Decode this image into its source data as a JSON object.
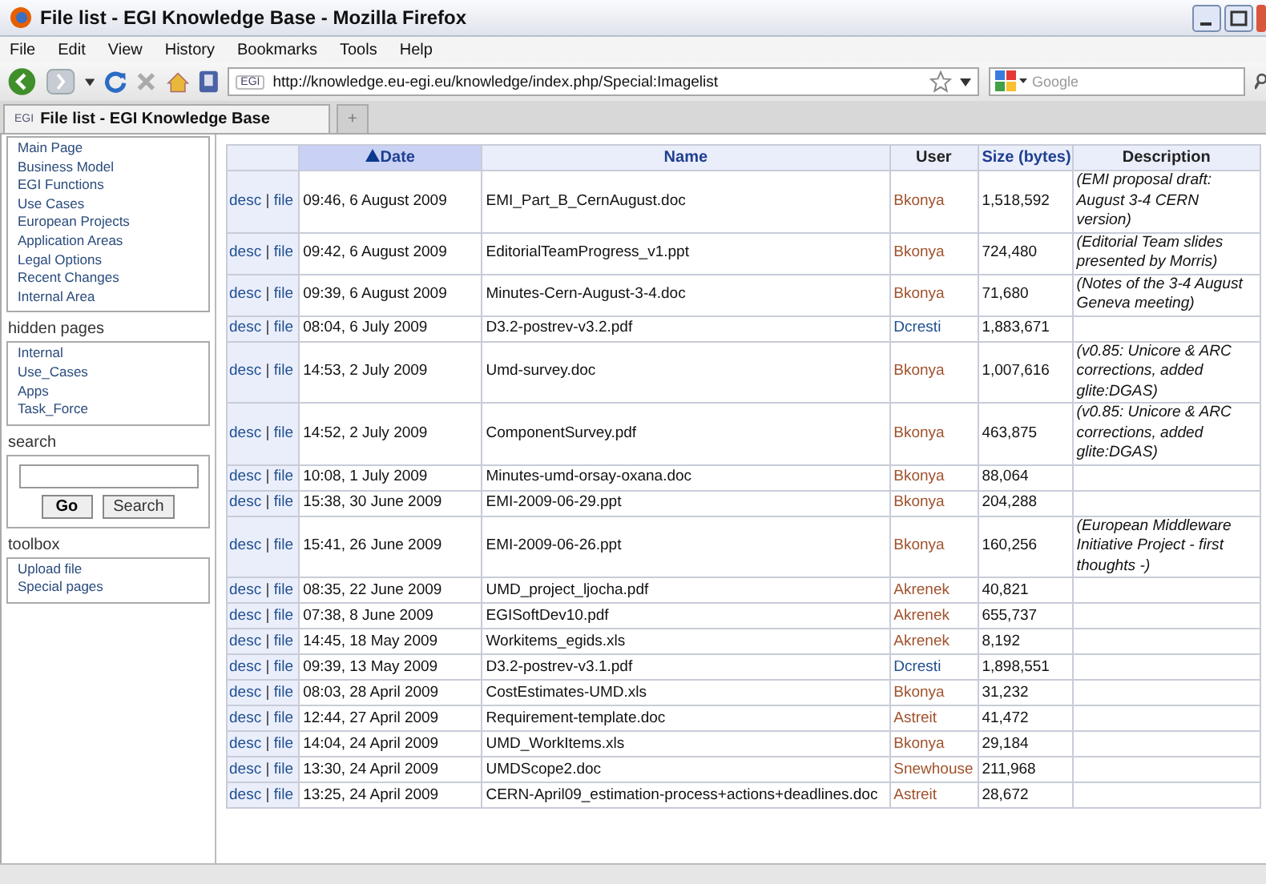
{
  "window": {
    "title": "File list - EGI Knowledge Base - Mozilla Firefox"
  },
  "menu": [
    "File",
    "Edit",
    "View",
    "History",
    "Bookmarks",
    "Tools",
    "Help"
  ],
  "address": {
    "site_badge": "EGI",
    "url": "http://knowledge.eu-egi.eu/knowledge/index.php/Special:Imagelist"
  },
  "web_search": {
    "placeholder": "Google"
  },
  "tabs": [
    {
      "badge": "EGI",
      "label": "File list - EGI Knowledge Base",
      "selected": true
    },
    {
      "label": "+",
      "selected": false
    }
  ],
  "sidebar": {
    "navigation": [
      "Main Page",
      "Business Model",
      "EGI Functions",
      "Use Cases",
      "European Projects",
      "Application Areas",
      "Legal Options",
      "Recent Changes",
      "Internal Area"
    ],
    "hidden_pages": {
      "title": "hidden pages",
      "items": [
        "Internal",
        "Use_Cases",
        "Apps",
        "Task_Force"
      ]
    },
    "search": {
      "title": "search",
      "go": "Go",
      "search": "Search"
    },
    "toolbox": {
      "title": "toolbox",
      "items": [
        "Upload file",
        "Special pages"
      ]
    }
  },
  "table": {
    "columns": [
      {
        "label": "Date",
        "sortable": true,
        "sorted": true
      },
      {
        "label": "Name",
        "sortable": true,
        "sorted": false
      },
      {
        "label": "User",
        "sortable": false,
        "sorted": false
      },
      {
        "label": "Size (bytes)",
        "sortable": true,
        "sorted": false
      },
      {
        "label": "Description",
        "sortable": false,
        "sorted": false
      }
    ],
    "rows": [
      {
        "desc": "desc",
        "sep": "|",
        "file": "file",
        "date": "09:46, 6 August 2009",
        "name": "EMI_Part_B_CernAugust.doc",
        "user": "Bkonya",
        "color": "#a0522d",
        "size": "1,518,592",
        "description": "(EMI proposal draft: August 3-4 CERN version)"
      },
      {
        "desc": "desc",
        "sep": "|",
        "file": "file",
        "date": "09:42, 6 August 2009",
        "name": "EditorialTeamProgress_v1.ppt",
        "user": "Bkonya",
        "color": "#a0522d",
        "size": "724,480",
        "description": "(Editorial Team slides presented by Morris)"
      },
      {
        "desc": "desc",
        "sep": "|",
        "file": "file",
        "date": "09:39, 6 August 2009",
        "name": "Minutes-Cern-August-3-4.doc",
        "user": "Bkonya",
        "color": "#a0522d",
        "size": "71,680",
        "description": "(Notes of the 3-4 August Geneva meeting)"
      },
      {
        "desc": "desc",
        "sep": "|",
        "file": "file",
        "date": "08:04, 6 July 2009",
        "name": "D3.2-postrev-v3.2.pdf",
        "user": "Dcresti",
        "color": "#1f4f8f",
        "size": "1,883,671"
      },
      {
        "desc": "desc",
        "sep": "|",
        "file": "file",
        "date": "14:53, 2 July 2009",
        "name": "Umd-survey.doc",
        "user": "Bkonya",
        "color": "#a0522d",
        "size": "1,007,616",
        "description": "(v0.85: Unicore & ARC corrections, added glite:DGAS)"
      },
      {
        "desc": "desc",
        "sep": "|",
        "file": "file",
        "date": "14:52, 2 July 2009",
        "name": "ComponentSurvey.pdf",
        "user": "Bkonya",
        "color": "#a0522d",
        "size": "463,875",
        "description": "(v0.85: Unicore & ARC corrections, added glite:DGAS)"
      },
      {
        "desc": "desc",
        "sep": "|",
        "file": "file",
        "date": "10:08, 1 July 2009",
        "name": "Minutes-umd-orsay-oxana.doc",
        "user": "Bkonya",
        "color": "#a0522d",
        "size": "88,064"
      },
      {
        "desc": "desc",
        "sep": "|",
        "file": "file",
        "date": "15:38, 30 June 2009",
        "name": "EMI-2009-06-29.ppt",
        "user": "Bkonya",
        "color": "#a0522d",
        "size": "204,288"
      },
      {
        "desc": "desc",
        "sep": "|",
        "file": "file",
        "date": "15:41, 26 June 2009",
        "name": "EMI-2009-06-26.ppt",
        "user": "Bkonya",
        "color": "#a0522d",
        "size": "160,256",
        "description": "(European Middleware Initiative Project - first thoughts -)"
      },
      {
        "desc": "desc",
        "sep": "|",
        "file": "file",
        "date": "08:35, 22 June 2009",
        "name": "UMD_project_ljocha.pdf",
        "user": "Akrenek",
        "color": "#a0522d",
        "size": "40,821"
      },
      {
        "desc": "desc",
        "sep": "|",
        "file": "file",
        "date": "07:38, 8 June 2009",
        "name": "EGISoftDev10.pdf",
        "user": "Akrenek",
        "color": "#a0522d",
        "size": "655,737"
      },
      {
        "desc": "desc",
        "sep": "|",
        "file": "file",
        "date": "14:45, 18 May 2009",
        "name": "Workitems_egids.xls",
        "user": "Akrenek",
        "color": "#a0522d",
        "size": "8,192"
      },
      {
        "desc": "desc",
        "sep": "|",
        "file": "file",
        "date": "09:39, 13 May 2009",
        "name": "D3.2-postrev-v3.1.pdf",
        "user": "Dcresti",
        "color": "#1f4f8f",
        "size": "1,898,551"
      },
      {
        "desc": "desc",
        "sep": "|",
        "file": "file",
        "date": "08:03, 28 April 2009",
        "name": "CostEstimates-UMD.xls",
        "user": "Bkonya",
        "color": "#a0522d",
        "size": "31,232"
      },
      {
        "desc": "desc",
        "sep": "|",
        "file": "file",
        "date": "12:44, 27 April 2009",
        "name": "Requirement-template.doc",
        "user": "Astreit",
        "color": "#a0522d",
        "size": "41,472"
      },
      {
        "desc": "desc",
        "sep": "|",
        "file": "file",
        "date": "14:04, 24 April 2009",
        "name": "UMD_WorkItems.xls",
        "user": "Bkonya",
        "color": "#a0522d",
        "size": "29,184"
      },
      {
        "desc": "desc",
        "sep": "|",
        "file": "file",
        "date": "13:30, 24 April 2009",
        "name": "UMDScope2.doc",
        "user": "Snewhouse",
        "color": "#a0522d",
        "size": "211,968"
      },
      {
        "desc": "desc",
        "sep": "|",
        "file": "file",
        "date": "13:25, 24 April 2009",
        "name": "CERN-April09_estimation-process+actions+deadlines.doc",
        "user": "Astreit",
        "color": "#a0522d",
        "size": "28,672"
      }
    ]
  }
}
